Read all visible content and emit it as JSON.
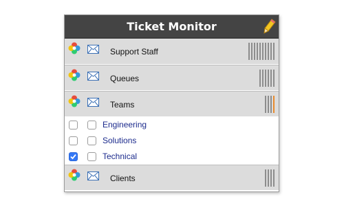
{
  "header": {
    "title": "Ticket Monitor"
  },
  "rows": [
    {
      "label": "Support Staff",
      "bars": 10,
      "orange": 0
    },
    {
      "label": "Queues",
      "bars": 6,
      "orange": 0
    },
    {
      "label": "Teams",
      "bars": 3,
      "orange": 1
    }
  ],
  "teams": [
    {
      "label": "Engineering",
      "checked": false
    },
    {
      "label": "Solutions",
      "checked": false
    },
    {
      "label": "Technical",
      "checked": true
    }
  ],
  "footer_row": {
    "label": "Clients",
    "bars": 4,
    "orange": 0
  },
  "colors": {
    "header_bg": "#444444",
    "row_bg": "#dcdcdc",
    "link": "#1b2a8c",
    "accent": "#e88a2c",
    "check": "#3478f6"
  },
  "icons": {
    "app": "app-logo-icon",
    "mail": "envelope-icon",
    "edit": "pencil-icon"
  }
}
